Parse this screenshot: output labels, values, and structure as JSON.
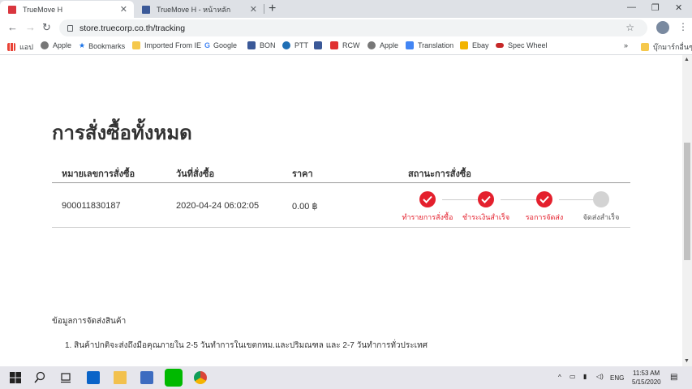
{
  "tabs": [
    {
      "title": "TrueMove H",
      "active": true
    },
    {
      "title": "TrueMove H - หน้าหลัก",
      "active": false
    }
  ],
  "url": "store.truecorp.co.th/tracking",
  "bookmarks": {
    "apps": "แอป",
    "items": [
      "Apple",
      "Bookmarks",
      "Imported From IE",
      "Google",
      "BON",
      "PTT",
      "",
      "RCW",
      "Apple",
      "Translation",
      "Ebay",
      "Spec Wheel"
    ],
    "more": "»",
    "other": "บุ๊กมาร์กอื่นๆ"
  },
  "page": {
    "title": "การสั่งซื้อทั้งหมด",
    "headers": [
      "หมายเลขการสั่งซื้อ",
      "วันที่สั่งซื้อ",
      "ราคา",
      "สถานะการสั่งซื้อ"
    ],
    "row": {
      "order_no": "900011830187",
      "date": "2020-04-24  06:02:05",
      "price": "0.00 ฿"
    },
    "steps": [
      {
        "label": "ทำรายการสั่งซื้อ",
        "done": true
      },
      {
        "label": "ชำระเงินสำเร็จ",
        "done": true
      },
      {
        "label": "รอการจัดส่ง",
        "done": true
      },
      {
        "label": "จัดส่งสำเร็จ",
        "done": false
      }
    ],
    "info_title": "ข้อมูลการจัดส่งสินค้า",
    "info_item": "1.  สินค้าปกติจะส่งถึงมือคุณภายใน 2-5 วันทำการในเขตกทม.และปริมณฑล และ 2-7 วันทำการทั่วประเทศ"
  },
  "taskbar": {
    "lang": "ENG",
    "time": "11:53 AM",
    "date": "5/15/2020"
  },
  "colors": {
    "accent_red": "#e4202d",
    "pending_gray": "#d3d3d3"
  }
}
